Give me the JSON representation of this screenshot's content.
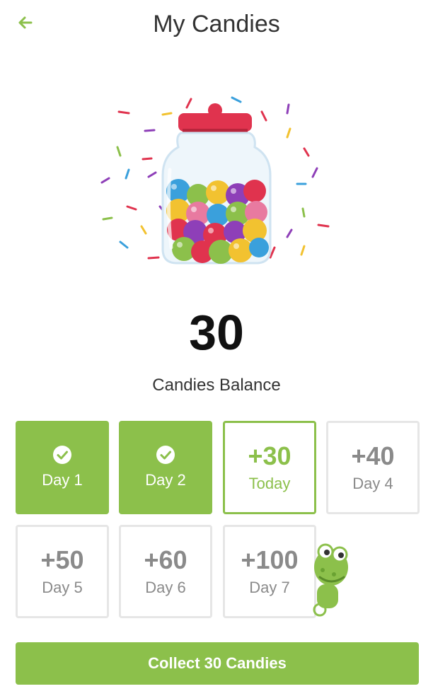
{
  "header": {
    "title": "My Candies",
    "back_icon": "arrow-left-icon"
  },
  "colors": {
    "accent": "#8cc04b",
    "future_border": "#e6e6e6",
    "future_text": "#8a8a8a",
    "lid": "#e0334e"
  },
  "illustration": {
    "icon": "candy-jar-illustration"
  },
  "balance": {
    "value": "30",
    "label": "Candies Balance"
  },
  "days": [
    {
      "label": "Day 1",
      "state": "collected",
      "icon": "check-circle-icon"
    },
    {
      "label": "Day 2",
      "state": "collected",
      "icon": "check-circle-icon"
    },
    {
      "amount": "+30",
      "label": "Today",
      "state": "today"
    },
    {
      "amount": "+40",
      "label": "Day 4",
      "state": "upcoming"
    },
    {
      "amount": "+50",
      "label": "Day 5",
      "state": "upcoming"
    },
    {
      "amount": "+60",
      "label": "Day 6",
      "state": "upcoming"
    },
    {
      "amount": "+100",
      "label": "Day 7",
      "state": "upcoming"
    }
  ],
  "mascot": {
    "icon": "frog-mascot-icon"
  },
  "collect_button": {
    "label": "Collect 30 Candies"
  }
}
